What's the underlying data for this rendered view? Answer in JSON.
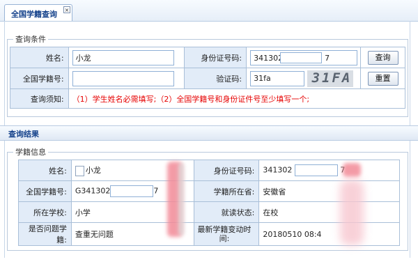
{
  "tab": {
    "label": "全国学籍查询",
    "close": "×"
  },
  "query": {
    "legend": "查询条件",
    "name_label": "姓名:",
    "name_value": "小龙",
    "id_label": "身份证号码:",
    "id_prefix": "341302",
    "id_suffix": "7",
    "query_button": "查询",
    "student_no_label": "全国学籍号:",
    "student_no_value": "",
    "captcha_label": "验证码:",
    "captcha_value": "31fa",
    "captcha_image_text": "31FA",
    "reset_button": "重置",
    "notice_label": "查询须知:",
    "notice_text": "（1）学生姓名必需填写;（2）全国学籍号和身份证件号至少填写一个;"
  },
  "results": {
    "header": "查询结果",
    "legend": "学籍信息",
    "name_label": "姓名:",
    "name_value": "小龙",
    "id_label": "身份证号码:",
    "id_prefix": "341302",
    "id_suffix": "7",
    "student_no_label": "全国学籍号:",
    "student_no_prefix": "G341302",
    "student_no_suffix": "7",
    "province_label": "学籍所在省:",
    "province_value": "安徽省",
    "school_label": "所在学校:",
    "school_value": "小学",
    "status_label": "就读状态:",
    "status_value": "在校",
    "problem_label": "是否问题学籍:",
    "problem_value": "查重无问题",
    "change_time_label": "最新学籍变动时间:",
    "change_time_value": "20180510 08:4"
  },
  "colors": {
    "label_bg": "#e2ecf8",
    "border": "#a9bfd8",
    "notice_red": "#e60000",
    "title_blue": "#15428b"
  }
}
